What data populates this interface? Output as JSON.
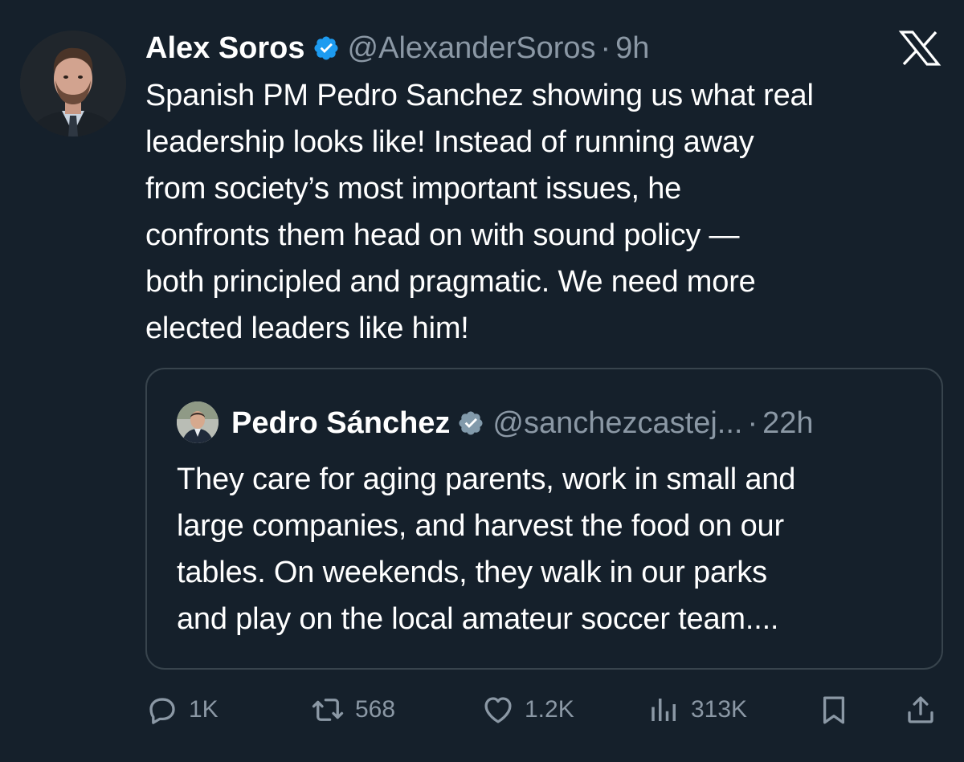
{
  "tweet": {
    "author_name": "Alex Soros",
    "handle": "@AlexanderSoros",
    "separator": "·",
    "time": "9h",
    "text": "Spanish PM Pedro Sanchez showing us what real\nleadership looks like! Instead of running away\nfrom society’s most important issues, he\nconfronts them head on with sound policy —\nboth principled and pragmatic. We need more\nelected leaders like him!"
  },
  "quoted": {
    "author_name": "Pedro Sánchez",
    "handle": "@sanchezcastej...",
    "separator": "·",
    "time": "22h",
    "text": "They care for aging parents, work in small and\nlarge companies, and harvest the food on our\ntables. On weekends, they walk in our parks\nand play on the local amateur soccer team...."
  },
  "actions": {
    "replies": "1K",
    "reposts": "568",
    "likes": "1.2K",
    "views": "313K"
  },
  "icons": {
    "verified": "verified-badge-icon",
    "platform": "x-logo-icon",
    "reply": "reply-icon",
    "repost": "repost-icon",
    "like": "heart-icon",
    "views": "views-icon",
    "bookmark": "bookmark-icon",
    "share": "share-icon"
  },
  "colors": {
    "background": "#15202b",
    "primary_text": "#ffffff",
    "secondary_text": "#8b98a5",
    "verified_badge": "#1d9bf0",
    "quote_verified_badge": "#829aab",
    "border": "#38444d"
  }
}
